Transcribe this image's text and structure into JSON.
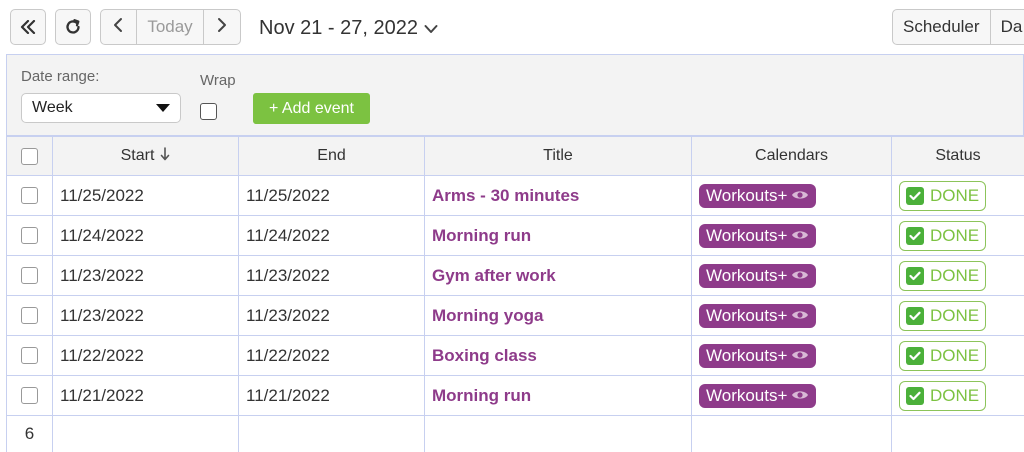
{
  "toolbar": {
    "today_label": "Today",
    "date_range": "Nov 21 - 27, 2022",
    "views": [
      "Scheduler",
      "Da"
    ]
  },
  "filters": {
    "date_range_label": "Date range:",
    "date_range_value": "Week",
    "wrap_label": "Wrap",
    "wrap_checked": false,
    "add_event_label": "+ Add event"
  },
  "grid": {
    "columns": [
      "Start",
      "End",
      "Title",
      "Calendars",
      "Status"
    ],
    "sort_column": "Start",
    "sort_direction": "descending",
    "rows": [
      {
        "start": "11/25/2022",
        "end": "11/25/2022",
        "title": "Arms - 30 minutes",
        "calendar": "Workouts+",
        "status": "DONE"
      },
      {
        "start": "11/24/2022",
        "end": "11/24/2022",
        "title": "Morning run",
        "calendar": "Workouts+",
        "status": "DONE"
      },
      {
        "start": "11/23/2022",
        "end": "11/23/2022",
        "title": "Gym after work",
        "calendar": "Workouts+",
        "status": "DONE"
      },
      {
        "start": "11/23/2022",
        "end": "11/23/2022",
        "title": "Morning yoga",
        "calendar": "Workouts+",
        "status": "DONE"
      },
      {
        "start": "11/22/2022",
        "end": "11/22/2022",
        "title": "Boxing class",
        "calendar": "Workouts+",
        "status": "DONE"
      },
      {
        "start": "11/21/2022",
        "end": "11/21/2022",
        "title": "Morning run",
        "calendar": "Workouts+",
        "status": "DONE"
      }
    ],
    "row_count": "6"
  },
  "colors": {
    "accent_purple": "#8e3b8a",
    "add_green": "#7cc241",
    "done_green": "#4bb03a",
    "grid_line": "#c7d0f0"
  },
  "icons": {
    "collapse": "double-chevron-left-icon",
    "refresh": "refresh-icon",
    "prev": "chevron-left-icon",
    "next": "chevron-right-icon",
    "date_dropdown": "chevron-down-icon",
    "sort": "arrow-down-icon",
    "calendar_visibility": "eye-icon",
    "status_done": "check-box-icon"
  }
}
